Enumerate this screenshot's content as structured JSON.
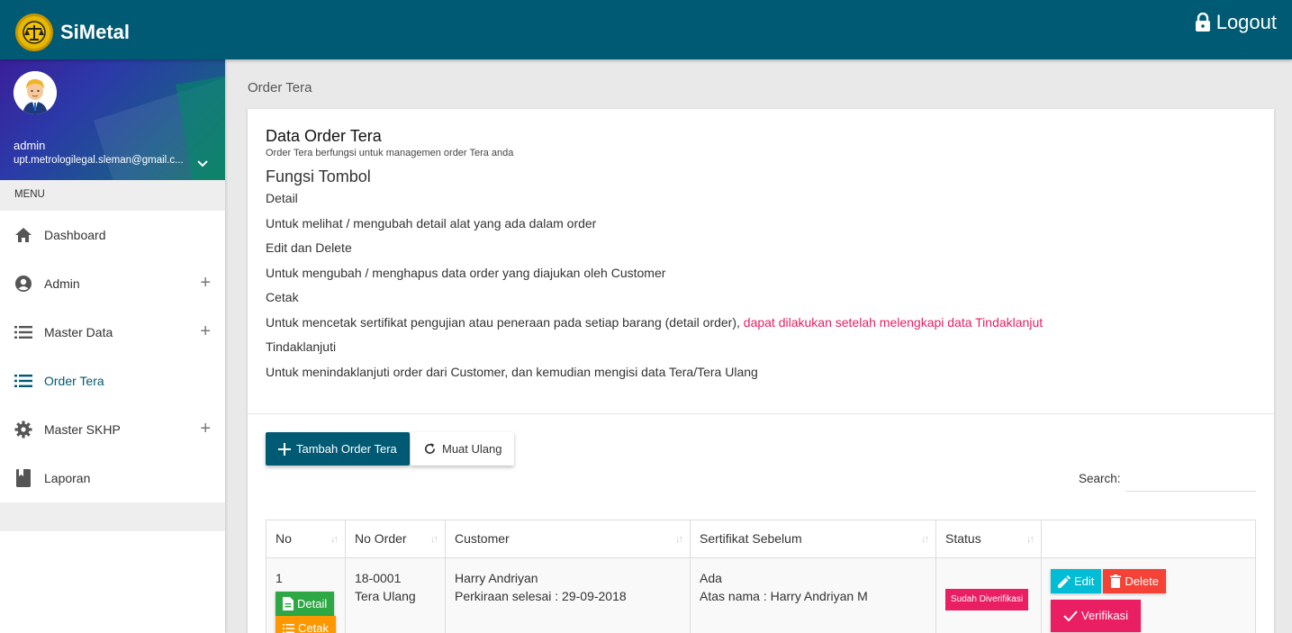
{
  "app": {
    "name": "SiMetal",
    "logout_label": "Logout"
  },
  "user": {
    "name": "admin",
    "email": "upt.metrologilegal.sleman@gmail.c..."
  },
  "menu": {
    "header": "MENU",
    "items": [
      {
        "label": "Dashboard",
        "icon": "home-icon",
        "expandable": false,
        "active": false
      },
      {
        "label": "Admin",
        "icon": "account-circle-icon",
        "expandable": true,
        "active": false
      },
      {
        "label": "Master Data",
        "icon": "list-icon",
        "expandable": true,
        "active": false
      },
      {
        "label": "Order Tera",
        "icon": "list-icon",
        "expandable": false,
        "active": true
      },
      {
        "label": "Master SKHP",
        "icon": "gear-icon",
        "expandable": true,
        "active": false
      },
      {
        "label": "Laporan",
        "icon": "book-icon",
        "expandable": false,
        "active": false
      }
    ]
  },
  "page": {
    "title": "Order Tera"
  },
  "card": {
    "title": "Data Order Tera",
    "subtitle": "Order Tera berfungsi untuk managemen order Tera anda",
    "fungsi_title": "Fungsi Tombol",
    "lines": {
      "detail": "Detail",
      "detail_desc": "Untuk melihat / mengubah detail alat yang ada dalam order",
      "edit_delete": "Edit dan Delete",
      "edit_delete_desc": "Untuk mengubah / menghapus data order yang diajukan oleh Customer",
      "cetak": "Cetak",
      "cetak_desc": "Untuk mencetak sertifikat pengujian atau peneraan pada setiap barang (detail order), ",
      "cetak_desc_red": "dapat dilakukan setelah melengkapi data Tindaklanjut",
      "tindak": "Tindaklanjuti",
      "tindak_desc": "Untuk menindaklanjuti order dari Customer, dan kemudian mengisi data Tera/Tera Ulang"
    }
  },
  "toolbar": {
    "add_label": "Tambah Order Tera",
    "reload_label": "Muat Ulang",
    "search_label": "Search:",
    "search_value": ""
  },
  "table": {
    "columns": [
      "No",
      "No Order",
      "Customer",
      "Sertifikat Sebelum",
      "Status",
      ""
    ],
    "rows": [
      {
        "no": "1",
        "detail_label": "Detail",
        "cetak_label": "Cetak",
        "order_no": "18-0001",
        "order_type": "Tera Ulang",
        "customer": "Harry Andriyan",
        "estimate": "Perkiraan selesai : 29-09-2018",
        "cert": "Ada",
        "cert_name": "Atas nama : Harry Andriyan M",
        "status": "Sudah Diverifikasi",
        "edit_label": "Edit",
        "delete_label": "Delete",
        "verify_label": "Verifikasi"
      }
    ]
  },
  "colors": {
    "primary": "#005a74",
    "accent_red": "#e91e63",
    "green": "#2ea845",
    "orange": "#ff9800",
    "cyan": "#00bcd4",
    "danger": "#f44336"
  }
}
